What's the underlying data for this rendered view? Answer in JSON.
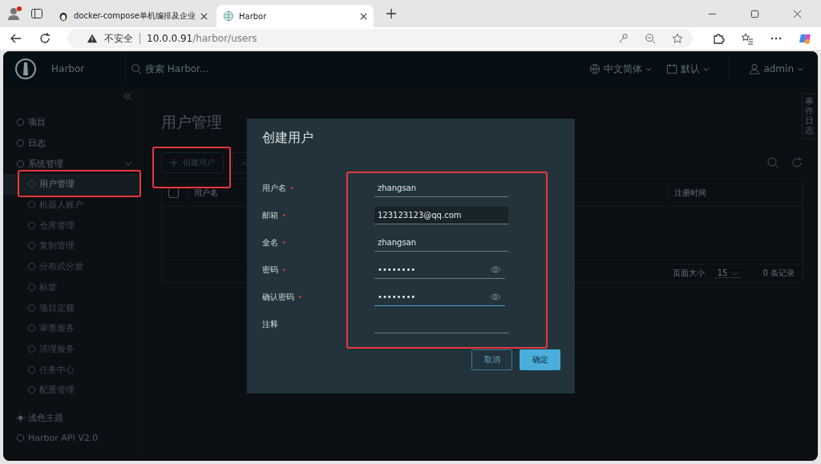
{
  "browser": {
    "tabs": [
      {
        "title": "docker-compose单机编排及企业",
        "selected": false
      },
      {
        "title": "Harbor",
        "selected": true
      }
    ],
    "security_label": "不安全",
    "url_host": "10.0.0.91",
    "url_path": "/harbor/users"
  },
  "header": {
    "app_name": "Harbor",
    "search_placeholder": "搜索 Harbor...",
    "language": "中文简体",
    "date_format": "默认",
    "user": "admin"
  },
  "sidebar": {
    "items": [
      {
        "label": "项目",
        "selected": false
      },
      {
        "label": "日志",
        "selected": false
      },
      {
        "label": "系统管理",
        "selected": false,
        "expanded": true,
        "children": [
          {
            "label": "用户管理",
            "selected": true
          },
          {
            "label": "机器人账户",
            "selected": false
          },
          {
            "label": "仓库管理",
            "selected": false
          },
          {
            "label": "复制管理",
            "selected": false
          },
          {
            "label": "分布式分发",
            "selected": false
          },
          {
            "label": "标签",
            "selected": false
          },
          {
            "label": "项目定额",
            "selected": false
          },
          {
            "label": "审查服务",
            "selected": false
          },
          {
            "label": "清理服务",
            "selected": false
          },
          {
            "label": "任务中心",
            "selected": false
          },
          {
            "label": "配置管理",
            "selected": false
          }
        ]
      }
    ],
    "theme_toggle": "浅色主题",
    "api_link": "Harbor API V2.0"
  },
  "page": {
    "title": "用户管理",
    "create_button": "创建用户",
    "table": {
      "select_all_checked": false,
      "columns": [
        {
          "label": "用户名"
        },
        {
          "label": "注册时间"
        }
      ],
      "page_size_label": "页面大小",
      "page_size": "15",
      "record_count": "0 条记录"
    }
  },
  "event_log_tab": "事件日志",
  "dialog": {
    "title": "创建用户",
    "fields": [
      {
        "label": "用户名",
        "kind": "text",
        "required": true,
        "value": "zhangsan",
        "focused": false,
        "autofilled": false
      },
      {
        "label": "邮箱",
        "kind": "text",
        "required": true,
        "value": "123123123@qq.com",
        "focused": false,
        "autofilled": true
      },
      {
        "label": "全名",
        "kind": "text",
        "required": true,
        "value": "zhangsan",
        "focused": false,
        "autofilled": false
      },
      {
        "label": "密码",
        "kind": "password",
        "required": true,
        "value": "••••••••",
        "focused": false,
        "autofilled": false
      },
      {
        "label": "确认密码",
        "kind": "password",
        "required": true,
        "value": "••••••••",
        "focused": true,
        "autofilled": false
      },
      {
        "label": "注释",
        "kind": "text",
        "required": false,
        "focused": false,
        "autofilled": false
      }
    ],
    "buttons": [
      {
        "label": "取消",
        "kind": "secondary"
      },
      {
        "label": "确定",
        "kind": "primary"
      }
    ]
  }
}
